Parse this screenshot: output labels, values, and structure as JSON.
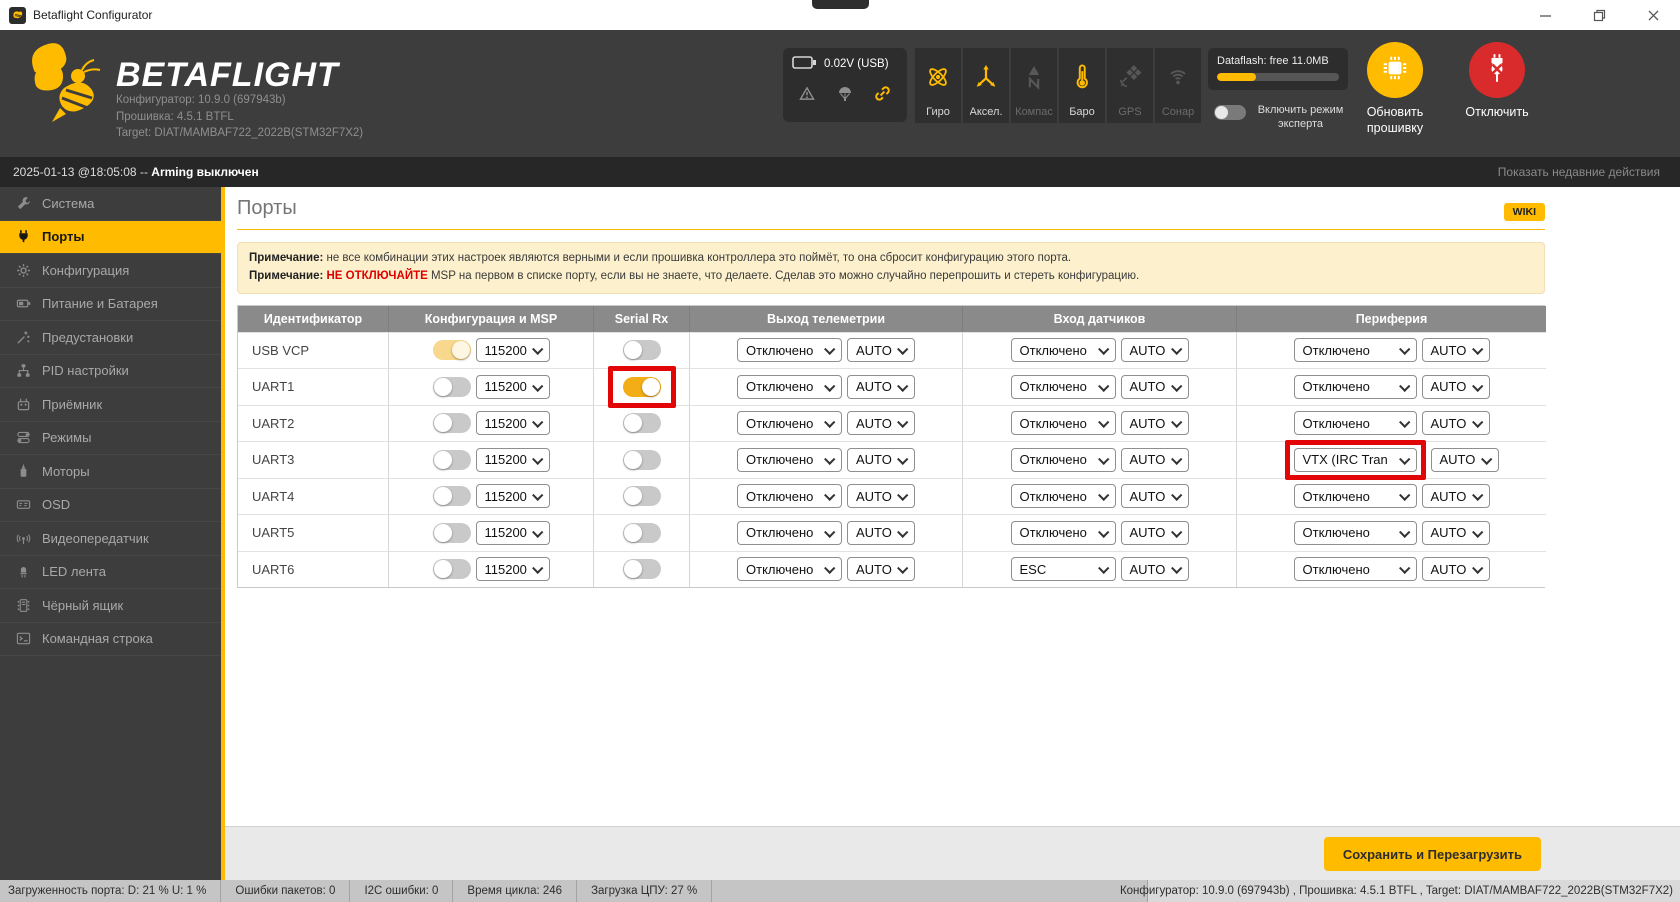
{
  "colors": {
    "accent": "#ffbb00",
    "danger": "#e20606",
    "header_bg": "#3d3d3d",
    "toggle_on": "#f2ae14",
    "footer_bg": "#c5c5c5"
  },
  "window": {
    "title": "Betaflight Configurator",
    "controls": [
      {
        "name": "minimize-button",
        "glyph": "minimize-icon"
      },
      {
        "name": "restore-button",
        "glyph": "restore-icon"
      },
      {
        "name": "close-button",
        "glyph": "close-icon"
      }
    ]
  },
  "header": {
    "logo": "BETAFLIGHT",
    "logo_icon": "bee-logo-icon",
    "version_lines": [
      "Конфигуратор: 10.9.0 (697943b)",
      "Прошивка: 4.5.1 BTFL",
      "Target: DIAT/MAMBAF722_2022B(STM32F7X2)"
    ],
    "battery": {
      "voltage": "0.02V (USB)",
      "icons": [
        "warning-icon",
        "failsafe-icon",
        "link-icon"
      ]
    },
    "sensors": [
      {
        "label": "Гиро",
        "icon": "gyro-icon",
        "active": true
      },
      {
        "label": "Аксел.",
        "icon": "accel-icon",
        "active": true
      },
      {
        "label": "Компас",
        "icon": "mag-icon",
        "active": false
      },
      {
        "label": "Баро",
        "icon": "baro-icon",
        "active": true
      },
      {
        "label": "GPS",
        "icon": "gps-icon",
        "active": false
      },
      {
        "label": "Сонар",
        "icon": "sonar-icon",
        "active": false
      }
    ],
    "dataflash": {
      "label": "Dataflash: free 11.0MB",
      "fill_pct": 32
    },
    "expert_label": "Включить режим эксперта",
    "expert_on": false,
    "update_label": "Обновить прошивку",
    "disconnect_label": "Отключить"
  },
  "logbar": {
    "time": "2025-01-13 @18:05:08 -- ",
    "status": "Arming выключен",
    "link": "Показать недавние действия"
  },
  "sidebar": {
    "items": [
      {
        "label": "Система",
        "icon": "wrench-icon",
        "active": false
      },
      {
        "label": "Порты",
        "icon": "plug-icon",
        "active": true
      },
      {
        "label": "Конфигурация",
        "icon": "gear-icon",
        "active": false
      },
      {
        "label": "Питание и Батарея",
        "icon": "battery-icon",
        "active": false
      },
      {
        "label": "Предустановки",
        "icon": "wand-icon",
        "active": false
      },
      {
        "label": "PID настройки",
        "icon": "sitemap-icon",
        "active": false
      },
      {
        "label": "Приёмник",
        "icon": "transmitter-icon",
        "active": false
      },
      {
        "label": "Режимы",
        "icon": "toggles-icon",
        "active": false
      },
      {
        "label": "Моторы",
        "icon": "motor-icon",
        "active": false
      },
      {
        "label": "OSD",
        "icon": "osd-icon",
        "active": false
      },
      {
        "label": "Видеопередатчик",
        "icon": "antenna-icon",
        "active": false
      },
      {
        "label": "LED лента",
        "icon": "led-icon",
        "active": false
      },
      {
        "label": "Чёрный ящик",
        "icon": "blackbox-icon",
        "active": false
      },
      {
        "label": "Командная строка",
        "icon": "terminal-icon",
        "active": false
      }
    ]
  },
  "content": {
    "title": "Порты",
    "wiki_label": "WIKI",
    "notes": [
      {
        "prefix": "Примечание:",
        "warning": "",
        "text": " не все комбинации этих настроек являются верными и если прошивка контроллера это поймёт, то она сбросит конфигурацию этого порта."
      },
      {
        "prefix": "Примечание:",
        "warning": " НЕ ОТКЛЮЧАЙТЕ",
        "text": " MSP на первом в списке порту, если вы не знаете, что делаете. Сделав это можно случайно перепрошить и стереть конфигурацию."
      }
    ],
    "table": {
      "columns": [
        "Идентификатор",
        "Конфигурация и MSP",
        "Serial Rx",
        "Выход телеметрии",
        "Вход датчиков",
        "Периферия"
      ],
      "rows": [
        {
          "id": "USB VCP",
          "msp": "pale",
          "baud": "115200",
          "serial_rx": "off",
          "serial_rx_highlight": false,
          "telemetry": [
            "Отключено",
            "AUTO"
          ],
          "sensors": [
            "Отключено",
            "AUTO"
          ],
          "peripherals": [
            "Отключено",
            "AUTO"
          ],
          "peripheral_highlight": false
        },
        {
          "id": "UART1",
          "msp": "off",
          "baud": "115200",
          "serial_rx": "on",
          "serial_rx_highlight": true,
          "telemetry": [
            "Отключено",
            "AUTO"
          ],
          "sensors": [
            "Отключено",
            "AUTO"
          ],
          "peripherals": [
            "Отключено",
            "AUTO"
          ],
          "peripheral_highlight": false
        },
        {
          "id": "UART2",
          "msp": "off",
          "baud": "115200",
          "serial_rx": "off",
          "serial_rx_highlight": false,
          "telemetry": [
            "Отключено",
            "AUTO"
          ],
          "sensors": [
            "Отключено",
            "AUTO"
          ],
          "peripherals": [
            "Отключено",
            "AUTO"
          ],
          "peripheral_highlight": false
        },
        {
          "id": "UART3",
          "msp": "off",
          "baud": "115200",
          "serial_rx": "off",
          "serial_rx_highlight": false,
          "telemetry": [
            "Отключено",
            "AUTO"
          ],
          "sensors": [
            "Отключено",
            "AUTO"
          ],
          "peripherals": [
            "VTX (IRC Tran",
            "AUTO"
          ],
          "peripheral_highlight": true
        },
        {
          "id": "UART4",
          "msp": "off",
          "baud": "115200",
          "serial_rx": "off",
          "serial_rx_highlight": false,
          "telemetry": [
            "Отключено",
            "AUTO"
          ],
          "sensors": [
            "Отключено",
            "AUTO"
          ],
          "peripherals": [
            "Отключено",
            "AUTO"
          ],
          "peripheral_highlight": false
        },
        {
          "id": "UART5",
          "msp": "off",
          "baud": "115200",
          "serial_rx": "off",
          "serial_rx_highlight": false,
          "telemetry": [
            "Отключено",
            "AUTO"
          ],
          "sensors": [
            "Отключено",
            "AUTO"
          ],
          "peripherals": [
            "Отключено",
            "AUTO"
          ],
          "peripheral_highlight": false
        },
        {
          "id": "UART6",
          "msp": "off",
          "baud": "115200",
          "serial_rx": "off",
          "serial_rx_highlight": false,
          "telemetry": [
            "Отключено",
            "AUTO"
          ],
          "sensors": [
            "ESC",
            "AUTO"
          ],
          "peripherals": [
            "Отключено",
            "AUTO"
          ],
          "peripheral_highlight": false
        }
      ]
    },
    "save_label": "Сохранить и Перезагрузить"
  },
  "footer": {
    "stats": [
      "Загруженность порта: D: 21 % U: 1 %",
      "Ошибки пакетов: 0",
      "I2C ошибки: 0",
      "Время цикла: 246",
      "Загрузка ЦПУ: 27 %"
    ],
    "right": "Конфигуратор: 10.9.0 (697943b) , Прошивка: 4.5.1 BTFL , Target: DIAT/MAMBAF722_2022B(STM32F7X2)"
  }
}
